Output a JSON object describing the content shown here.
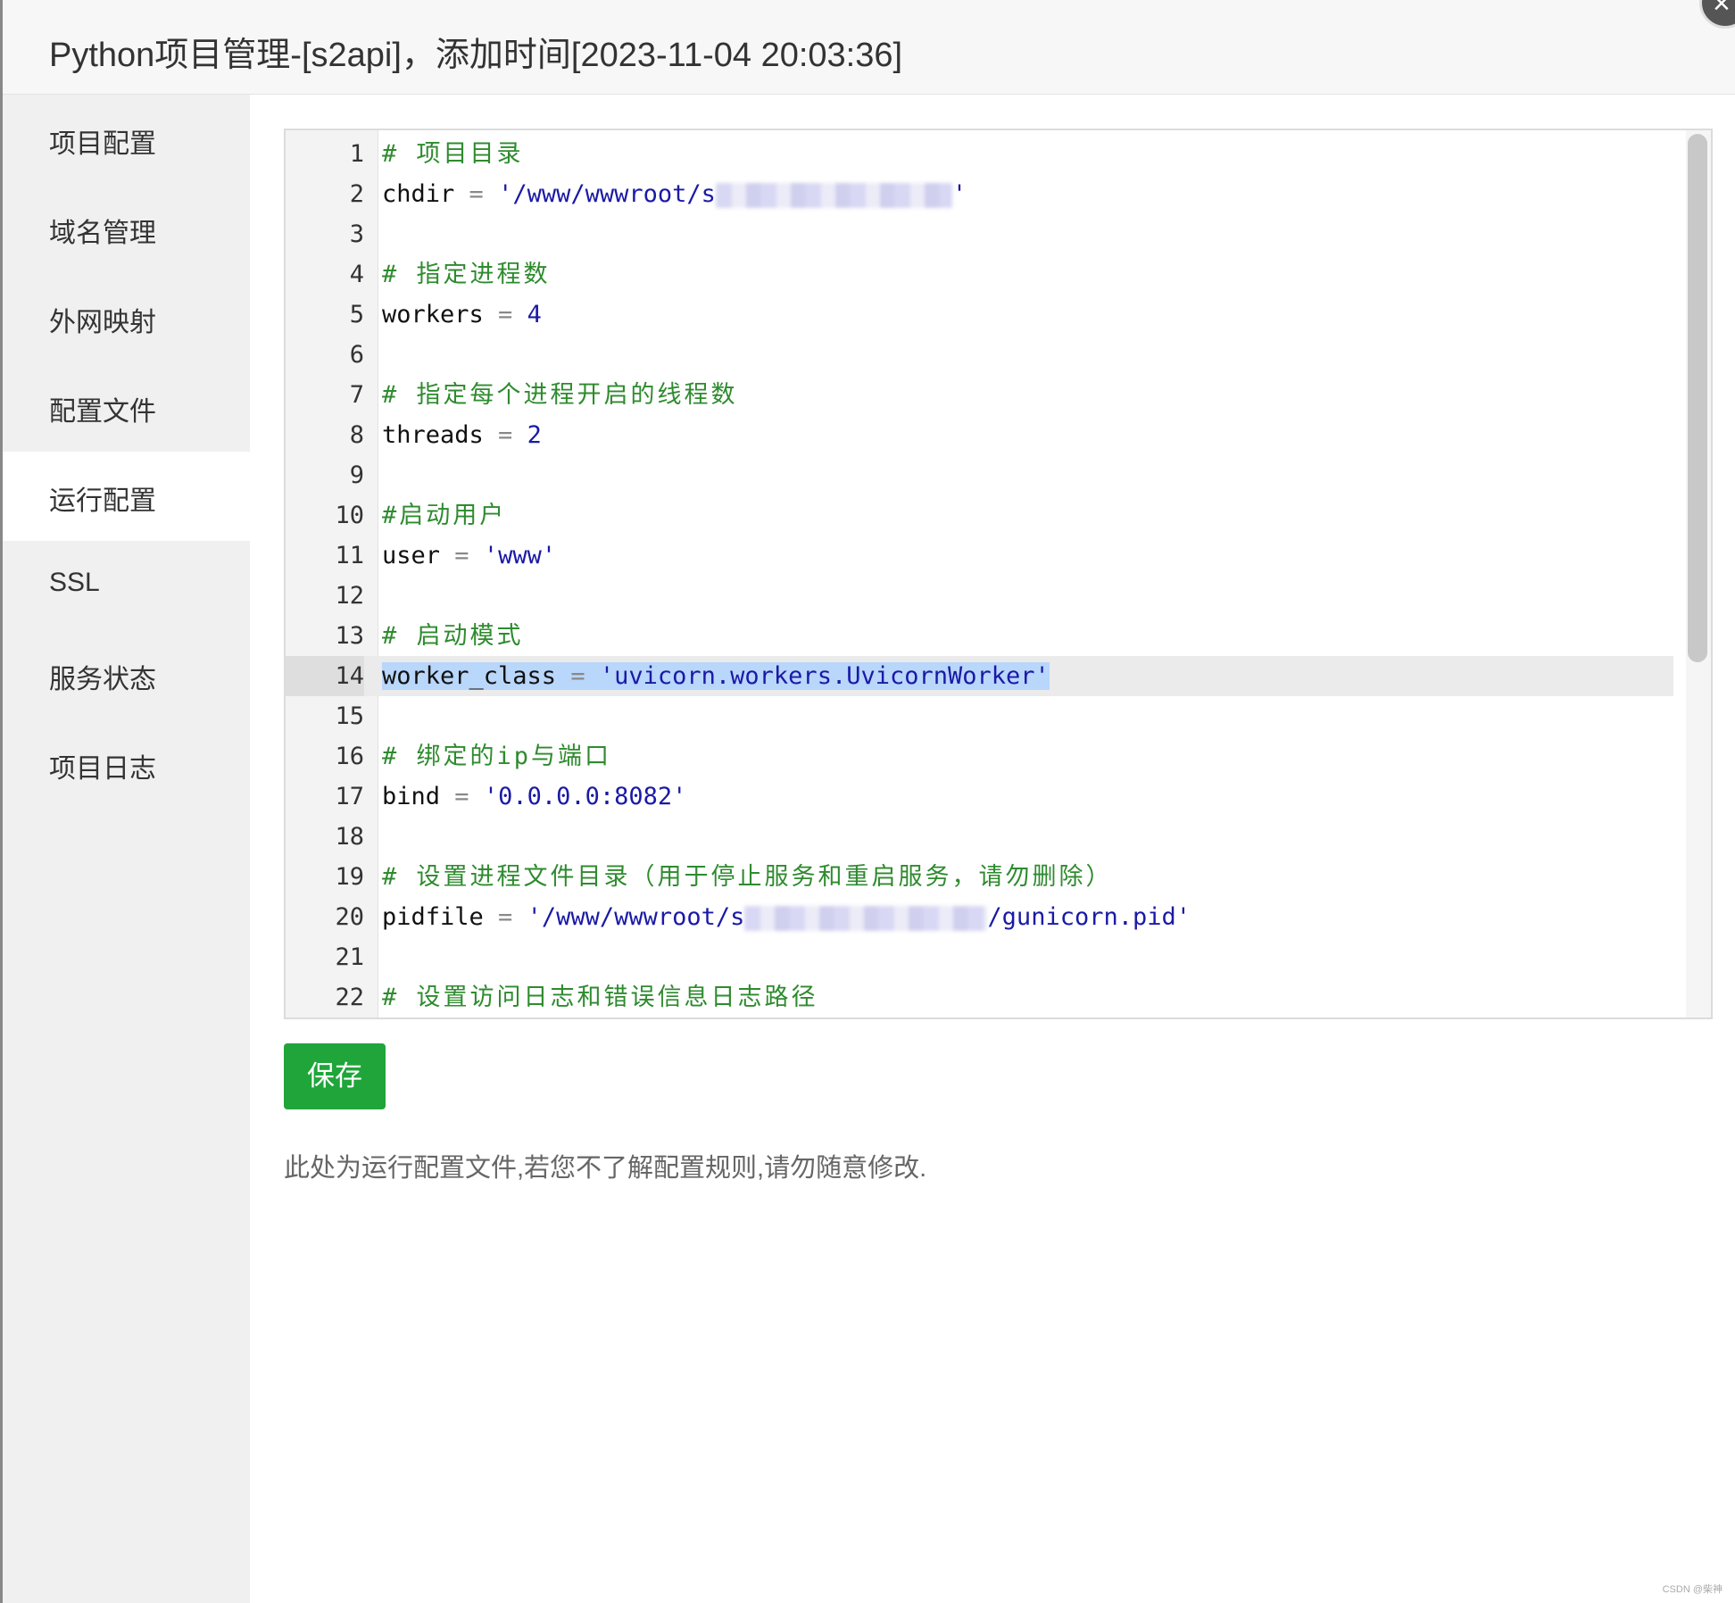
{
  "dialog": {
    "title": "Python项目管理-[s2api]，添加时间[2023-11-04 20:03:36]"
  },
  "sidebar": {
    "items": [
      {
        "label": "项目配置"
      },
      {
        "label": "域名管理"
      },
      {
        "label": "外网映射"
      },
      {
        "label": "配置文件"
      },
      {
        "label": "运行配置"
      },
      {
        "label": "SSL"
      },
      {
        "label": "服务状态"
      },
      {
        "label": "项目日志"
      }
    ],
    "active_index": 4
  },
  "editor": {
    "active_line": 14,
    "lines": [
      {
        "n": "1",
        "comment": "# 项目目录"
      },
      {
        "n": "2",
        "key": "chdir",
        "op": " = ",
        "str": "'/www/wwwroot/s",
        "str_end": "'"
      },
      {
        "n": "3"
      },
      {
        "n": "4",
        "comment": "# 指定进程数"
      },
      {
        "n": "5",
        "key": "workers",
        "op": " = ",
        "num": "4"
      },
      {
        "n": "6"
      },
      {
        "n": "7",
        "comment": "# 指定每个进程开启的线程数"
      },
      {
        "n": "8",
        "key": "threads",
        "op": " = ",
        "num": "2"
      },
      {
        "n": "9"
      },
      {
        "n": "10",
        "comment": "#启动用户"
      },
      {
        "n": "11",
        "key": "user",
        "op": " = ",
        "str": "'www'"
      },
      {
        "n": "12"
      },
      {
        "n": "13",
        "comment": "# 启动模式"
      },
      {
        "n": "14",
        "key": "worker_class",
        "op": " = ",
        "str": "'uvicorn.workers.UvicornWorker'"
      },
      {
        "n": "15"
      },
      {
        "n": "16",
        "comment": "# 绑定的ip与端口"
      },
      {
        "n": "17",
        "key": "bind",
        "op": " = ",
        "str": "'0.0.0.0:8082'"
      },
      {
        "n": "18"
      },
      {
        "n": "19",
        "comment": "# 设置进程文件目录（用于停止服务和重启服务，请勿删除）"
      },
      {
        "n": "20",
        "key": "pidfile",
        "op": " = ",
        "str": "'/www/wwwroot/s",
        "str_end": "/gunicorn.pid'"
      },
      {
        "n": "21"
      },
      {
        "n": "22",
        "comment": "# 设置访问日志和错误信息日志路径"
      }
    ]
  },
  "actions": {
    "save_label": "保存"
  },
  "hint": "此处为运行配置文件,若您不了解配置规则,请勿随意修改.",
  "watermark": "CSDN @柴神",
  "colors": {
    "accent_green": "#20a53a",
    "comment": "#2e8b2e",
    "string": "#1a1aa6",
    "selection": "#b9d6fb"
  }
}
